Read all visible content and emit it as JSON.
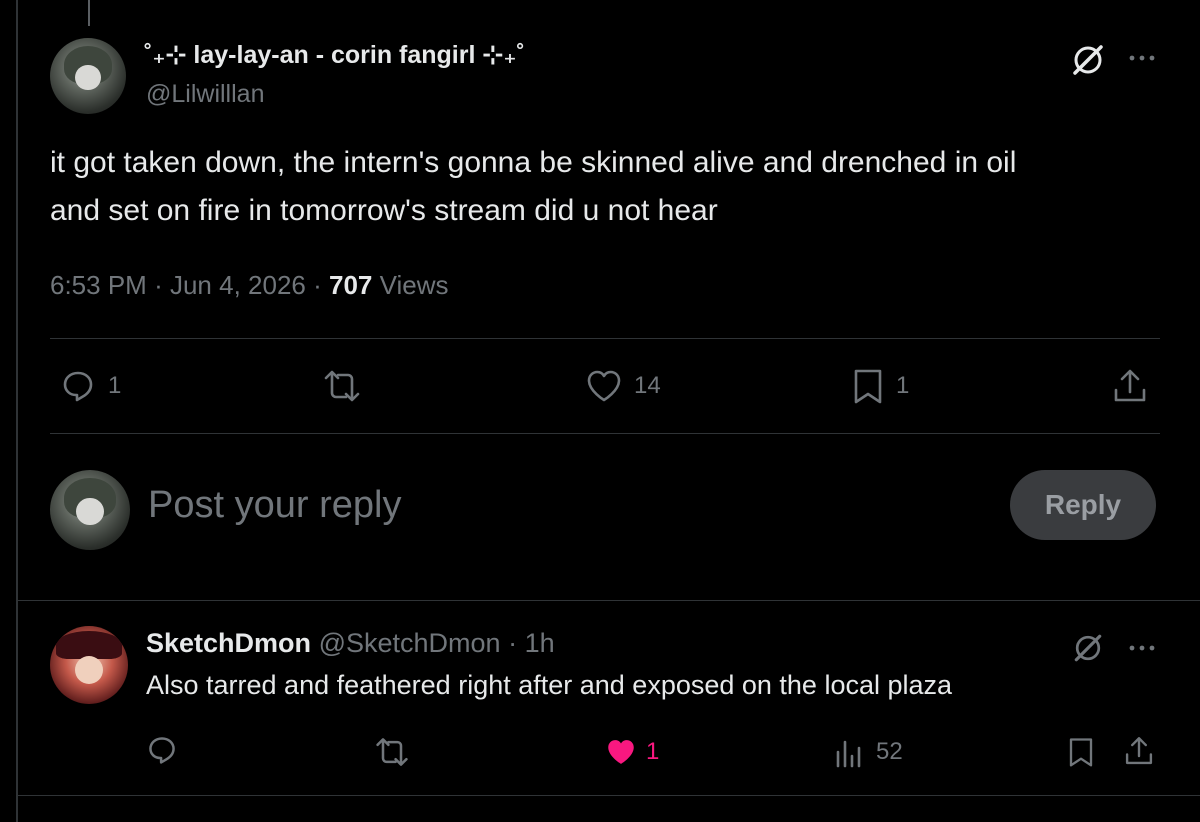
{
  "tweet": {
    "display_name": "˚₊⊹ lay-lay-an - corin fangirl ⊹₊˚",
    "handle": "@Lilwilllan",
    "text_line1": "it got taken down, the intern's gonna be skinned alive and drenched in oil",
    "text_line2": "and set on fire in tomorrow's stream did u not hear",
    "time": "6:53 PM",
    "dot": "·",
    "date": "Jun 4, 2026",
    "views_count": "707",
    "views_label": "Views",
    "reply_count": "1",
    "like_count": "14",
    "bookmark_count": "1"
  },
  "composer": {
    "placeholder": "Post your reply",
    "reply_button": "Reply"
  },
  "reply": {
    "display_name": "SketchDmon",
    "handle": "@SketchDmon",
    "dot": "·",
    "time": "1h",
    "text": "Also tarred and feathered right after and exposed on the local plaza",
    "like_count": "1",
    "views_count": "52"
  },
  "colors": {
    "background": "#000000",
    "text": "#e7e9ea",
    "muted": "#71767b",
    "divider": "#2f3336",
    "like_active": "#f91880",
    "reply_button_bg": "#3a3c3f"
  },
  "icons": {
    "grok": "grok-icon",
    "more": "more-icon",
    "reply": "reply-icon",
    "repost": "repost-icon",
    "like": "heart-icon",
    "bookmark": "bookmark-icon",
    "share": "share-icon",
    "views": "views-icon"
  }
}
